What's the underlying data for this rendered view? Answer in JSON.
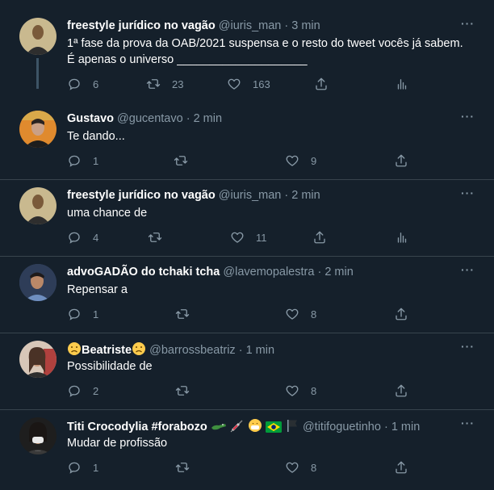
{
  "tweets": [
    {
      "name": "freestyle jurídico no vagão",
      "name_emoji": [],
      "handle": "@iuris_man",
      "time": "3 min",
      "text_line1": "1ª fase da prova da OAB/2021 suspensa e o resto do tweet vocês já sabem.",
      "text_line2": "É apenas o universo ____________________",
      "replies": "6",
      "retweets": "23",
      "likes": "163"
    },
    {
      "name": "Gustavo",
      "name_emoji": [],
      "handle": "@gucentavo",
      "time": "2 min",
      "text_line1": "Te dando...",
      "text_line2": "",
      "replies": "1",
      "retweets": "",
      "likes": "9"
    },
    {
      "name": "freestyle jurídico no vagão",
      "name_emoji": [],
      "handle": "@iuris_man",
      "time": "2 min",
      "text_line1": "uma chance de",
      "text_line2": "",
      "replies": "4",
      "retweets": "",
      "likes": "11"
    },
    {
      "name": "advoGADÃO do tchaki tcha",
      "name_emoji": [],
      "handle": "@lavemopalestra",
      "time": "2 min",
      "text_line1": "Repensar a",
      "text_line2": "",
      "replies": "1",
      "retweets": "",
      "likes": "8"
    },
    {
      "name": "Beatriste",
      "name_emoji": [
        "sad-face-emoji"
      ],
      "handle": "@barrossbeatriz",
      "time": "1 min",
      "text_line1": "Possibilidade de",
      "text_line2": "",
      "replies": "2",
      "retweets": "",
      "likes": "8"
    },
    {
      "name": "Titi Crocodylia #forabozo",
      "name_emoji": [
        "crocodile-emoji",
        "syringe-emoji",
        "mask-face-emoji",
        "brazil-flag-emoji",
        "black-flag-emoji"
      ],
      "handle": "@titifoguetinho",
      "time": "1 min",
      "text_line1": "Mudar de profissão",
      "text_line2": "",
      "replies": "1",
      "retweets": "",
      "likes": "8"
    }
  ],
  "ui": {
    "dot": "·",
    "more": "···"
  },
  "colors": {
    "background": "#15202b",
    "secondary_text": "#8899a6",
    "divider": "#38444d",
    "thread_line": "#3d5466"
  }
}
